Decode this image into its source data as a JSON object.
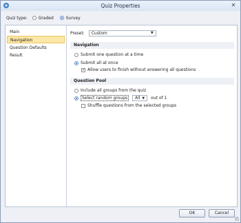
{
  "window": {
    "title": "Quiz Properties",
    "close_glyph": "✕",
    "icon": "app-gear-icon"
  },
  "quiz_type": {
    "label": "Quiz type:",
    "options": [
      {
        "label": "Graded",
        "selected": false
      },
      {
        "label": "Survey",
        "selected": true
      }
    ]
  },
  "sidebar": {
    "items": [
      {
        "label": "Main",
        "selected": false
      },
      {
        "label": "Navigation",
        "selected": true
      },
      {
        "label": "Question Defaults",
        "selected": false
      },
      {
        "label": "Result",
        "selected": false
      }
    ]
  },
  "preset": {
    "label": "Preset:",
    "value": "Custom"
  },
  "navigation": {
    "heading": "Navigation",
    "option_one": "Submit one question at a time",
    "option_all": "Submit all at once",
    "allow_finish": "Allow users to finish without answering all questions",
    "selected": "all",
    "allow_finish_checked": true
  },
  "question_pool": {
    "heading": "Question Pool",
    "include_all": "Include all groups from the quiz",
    "select_random": "Select random groups",
    "count_value": "All",
    "out_of": "out of 1",
    "shuffle": "Shuffle questions from the selected groups",
    "selected": "random",
    "shuffle_checked": false
  },
  "footer": {
    "ok": "OK",
    "cancel": "Cancel"
  },
  "colors": {
    "selection": "#fde7a6",
    "accent": "#2a62b8",
    "section_bg": "#edf0f5"
  }
}
